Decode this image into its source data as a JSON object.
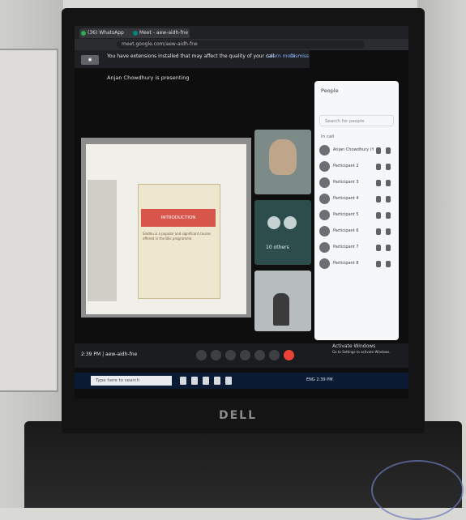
{
  "browser": {
    "tab1_title": "(36) WhatsApp",
    "tab2_title": "Meet - aew-aidh-fne",
    "url": "meet.google.com/aew-aidh-fne"
  },
  "meet": {
    "banner_text": "You have extensions installed that may affect the quality of your call",
    "banner_learn_more": "Learn more",
    "banner_dismiss": "Dismiss",
    "presenting_text": "Anjan Chowdhury is presenting",
    "slide_title": "INTRODUCTION",
    "slide_body": "Sindhu is a popular and significant course offered in the BSc programme.",
    "tile2_label": "10 others",
    "meeting_code": "2:39 PM | aew-aidh-fne",
    "activate_windows": "Activate Windows",
    "activate_sub": "Go to Settings to activate Windows."
  },
  "people_panel": {
    "title": "People",
    "search_placeholder": "Search for people",
    "section_label": "In call",
    "participants": [
      "Anjan Chowdhury (You)",
      "Participant 2",
      "Participant 3",
      "Participant 4",
      "Participant 5",
      "Participant 6",
      "Participant 7",
      "Participant 8"
    ]
  },
  "taskbar": {
    "search_placeholder": "Type here to search",
    "tray_text": "ENG 2:39 PM"
  },
  "brand": {
    "laptop_logo": "DELL"
  }
}
